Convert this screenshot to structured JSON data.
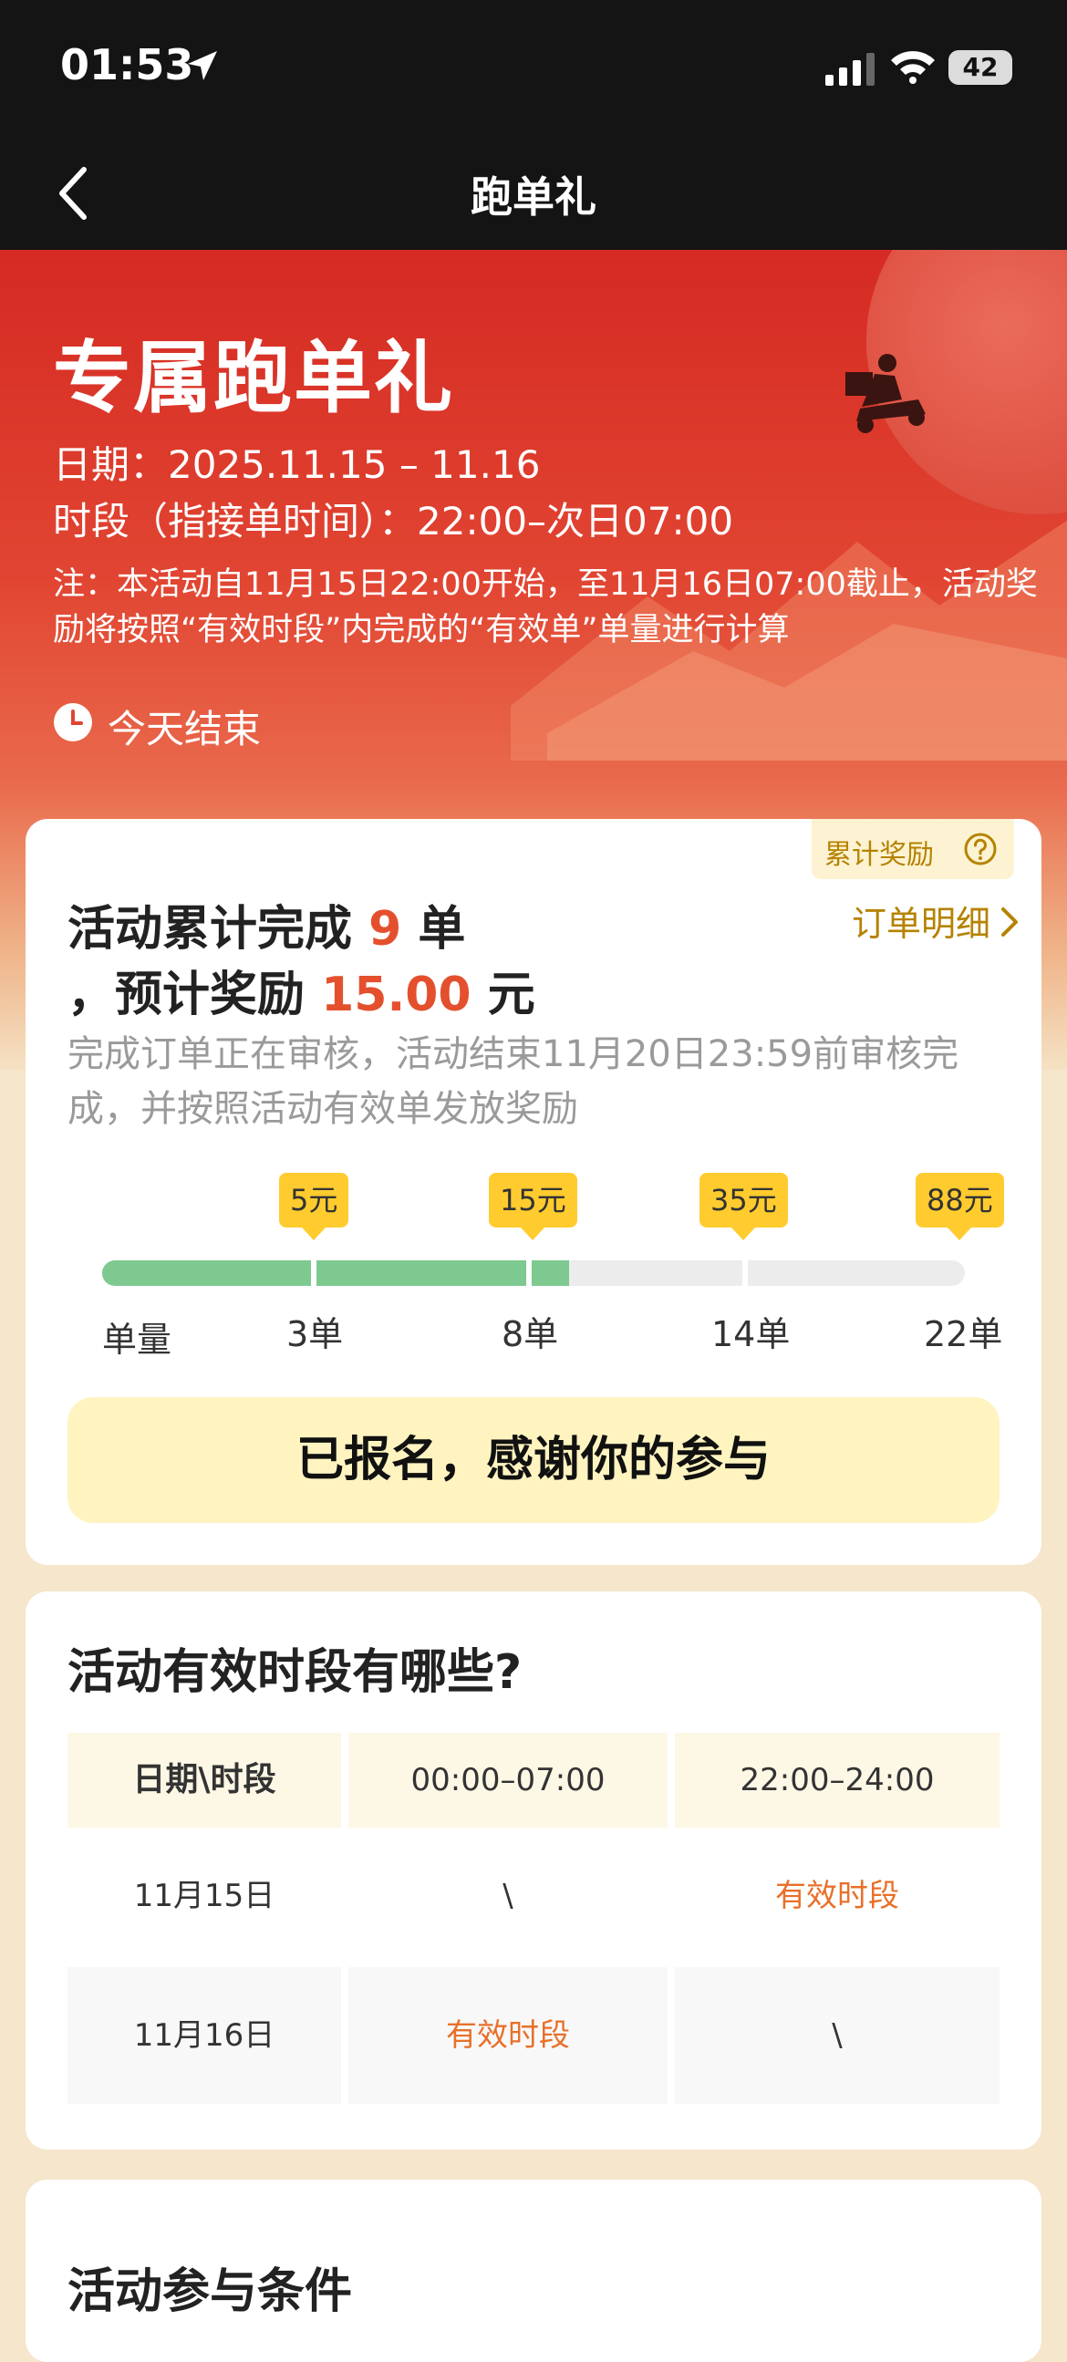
{
  "status_bar": {
    "time": "01:53",
    "battery": "42"
  },
  "nav": {
    "title": "跑单礼"
  },
  "hero": {
    "title": "专属跑单礼",
    "date": "日期：2025.11.15 – 11.16",
    "period": "时段（指接单时间）：22:00–次日07:00",
    "note": "注：本活动自11月15日22:00开始，至11月16日07:00截止，活动奖励将按照“有效时段”内完成的“有效单”单量进行计算",
    "ends": "今天结束"
  },
  "summary": {
    "reward_tag": "累计奖励",
    "line1_prefix": "活动累计完成",
    "orders_done": "9",
    "line1_suffix": "单",
    "line2_prefix": "，预计奖励",
    "reward_amount": "15.00",
    "line2_suffix": "元",
    "detail_link": "订单明细",
    "review_note": "完成订单正在审核，活动结束11月20日23:59前审核完成，并按照活动有效单发放奖励"
  },
  "progress": {
    "axis_label": "单量",
    "current": 9,
    "max": 22,
    "milestones": [
      {
        "reward": "5元",
        "label": "3单",
        "orders": 3
      },
      {
        "reward": "15元",
        "label": "8单",
        "orders": 8
      },
      {
        "reward": "35元",
        "label": "14单",
        "orders": 14
      },
      {
        "reward": "88元",
        "label": "22单",
        "orders": 22
      }
    ]
  },
  "signup_button": "已报名，感谢你的参与",
  "periods": {
    "title": "活动有效时段有哪些?",
    "headers": [
      "日期\\时段",
      "00:00–07:00",
      "22:00–24:00"
    ],
    "rows": [
      [
        "11月15日",
        "\\",
        "有效时段"
      ],
      [
        "11月16日",
        "有效时段",
        "\\"
      ]
    ]
  },
  "conditions": {
    "title": "活动参与条件"
  },
  "colors": {
    "accent": "#e4502d",
    "gold": "#b58300",
    "progress": "#7dc98f",
    "milestone": "#ffcb2e"
  }
}
